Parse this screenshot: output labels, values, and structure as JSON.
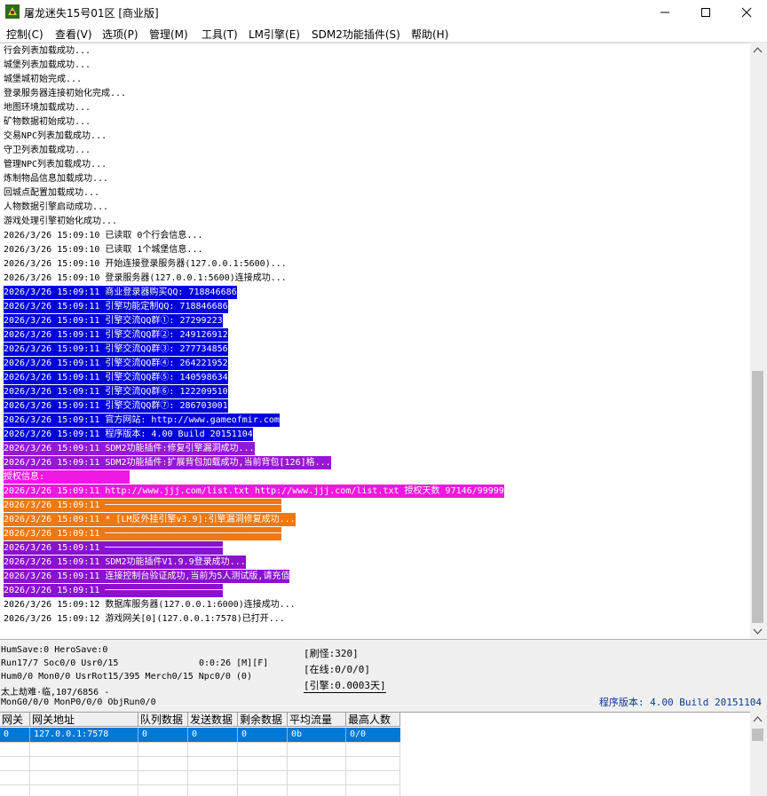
{
  "window": {
    "title": "屠龙迷失15号01区 [商业版]"
  },
  "menu": [
    "控制(C)",
    "查看(V)",
    "选项(P)",
    "管理(M)",
    "工具(T)",
    "LM引擎(E)",
    "SDM2功能插件(S)",
    "帮助(H)"
  ],
  "log": [
    {
      "text": "行会列表加载成功...",
      "style": "plain"
    },
    {
      "text": "城堡列表加载成功...",
      "style": "plain"
    },
    {
      "text": "城堡城初始完成...",
      "style": "plain"
    },
    {
      "text": "登录服务器连接初始化完成...",
      "style": "plain"
    },
    {
      "text": "地图环境加载成功...",
      "style": "plain"
    },
    {
      "text": "矿物数据初始成功...",
      "style": "plain"
    },
    {
      "text": "交易NPC列表加载成功...",
      "style": "plain"
    },
    {
      "text": "守卫列表加载成功...",
      "style": "plain"
    },
    {
      "text": "管理NPC列表加载成功...",
      "style": "plain"
    },
    {
      "text": "炼制物品信息加载成功...",
      "style": "plain"
    },
    {
      "text": "回城点配置加载成功...",
      "style": "plain"
    },
    {
      "text": "人物数据引擎启动成功...",
      "style": "plain"
    },
    {
      "text": "游戏处理引擎初始化成功...",
      "style": "plain"
    },
    {
      "text": "2026/3/26 15:09:10 已读取 0个行会信息...",
      "style": "plain"
    },
    {
      "text": "2026/3/26 15:09:10 已读取 1个城堡信息...",
      "style": "plain"
    },
    {
      "text": "2026/3/26 15:09:10 开始连接登录服务器(127.0.0.1:5600)...",
      "style": "plain"
    },
    {
      "text": "2026/3/26 15:09:10 登录服务器(127.0.0.1:5600)连接成功...",
      "style": "plain"
    },
    {
      "text": "2026/3/26 15:09:11 商业登录器购买QQ: 718846686",
      "style": "blue"
    },
    {
      "text": "2026/3/26 15:09:11 引擎功能定制QQ: 718846686",
      "style": "blue"
    },
    {
      "text": "2026/3/26 15:09:11 引擎交流QQ群①: 27299223",
      "style": "blue"
    },
    {
      "text": "2026/3/26 15:09:11 引擎交流QQ群②: 249126912",
      "style": "blue"
    },
    {
      "text": "2026/3/26 15:09:11 引擎交流QQ群③: 277734856",
      "style": "blue"
    },
    {
      "text": "2026/3/26 15:09:11 引擎交流QQ群④: 264221952",
      "style": "blue"
    },
    {
      "text": "2026/3/26 15:09:11 引擎交流QQ群⑤: 140598634",
      "style": "blue"
    },
    {
      "text": "2026/3/26 15:09:11 引擎交流QQ群⑥: 122209510",
      "style": "blue"
    },
    {
      "text": "2026/3/26 15:09:11 引擎交流QQ群⑦: 286703001",
      "style": "blue"
    },
    {
      "text": "2026/3/26 15:09:11 官方网站: http://www.gameofmir.com",
      "style": "blue"
    },
    {
      "text": "2026/3/26 15:09:11 程序版本: 4.00 Build 20151104",
      "style": "blue"
    },
    {
      "text": "2026/3/26 15:09:11 SDM2功能插件:修复引擎漏洞成功...",
      "style": "purple"
    },
    {
      "text": "2026/3/26 15:09:11 SDM2功能插件:扩展背包加载成功,当前背包[126]格...",
      "style": "purple"
    },
    {
      "text": "授权信息:                ",
      "style": "magenta"
    },
    {
      "text": "2026/3/26 15:09:11 http://www.jjj.com/list.txt http://www.jjj.com/list.txt 授权天数 97146/99999",
      "style": "magenta"
    },
    {
      "text": "2026/3/26 15:09:11 ─────────────────────────────────",
      "style": "orange"
    },
    {
      "text": "2026/3/26 15:09:11 * [LM反外挂引擎v3.9]:引擎漏洞修复成功...",
      "style": "orange"
    },
    {
      "text": "2026/3/26 15:09:11 ─────────────────────────────────",
      "style": "orange"
    },
    {
      "text": "2026/3/26 15:09:11 ──────────────────────",
      "style": "purple2"
    },
    {
      "text": "2026/3/26 15:09:11 SDM2功能插件V1.9.9登录成功...",
      "style": "purple2"
    },
    {
      "text": "2026/3/26 15:09:11 连接控制台验证成功,当前为5人测试版,请充值",
      "style": "purple2"
    },
    {
      "text": "2026/3/26 15:09:11 ──────────────────────",
      "style": "purple2"
    },
    {
      "text": "2026/3/26 15:09:12 数据库服务器(127.0.0.1:6000)连接成功...",
      "style": "plain"
    },
    {
      "text": "2026/3/26 15:09:12 游戏网关[0](127.0.0.1:7578)已打开...",
      "style": "plain"
    }
  ],
  "status": {
    "line1": "HumSave:0 HeroSave:0",
    "line2": "Run17/7 Soc0/0 Usr0/15",
    "timer": "0:0:26 [M][F]",
    "line3": "Hum0/0 Mon0/0 UsrRot15/395 Merch0/15 Npc0/0 (0)",
    "line4": "太上劫难·临,107/6856 -",
    "line5": "MonG0/0/0 MonP0/0/0 ObjRun0/0",
    "refresh": "[刷怪:320]",
    "online": "[在线:0/0/0]",
    "engine": "[引擎:0.0003天]",
    "version": "程序版本: 4.00 Build 20151104"
  },
  "grid": {
    "headers": [
      "网关",
      "网关地址",
      "队列数据",
      "发送数据",
      "剩余数据",
      "平均流量",
      "最高人数"
    ],
    "rows": [
      [
        "0",
        "127.0.0.1:7578",
        "0",
        "0",
        "0",
        "0b",
        "0/0"
      ]
    ]
  },
  "colors": {
    "blue": "#0000dc",
    "purple": "#9717d4",
    "magenta": "#ef18e0",
    "orange": "#f07810",
    "selection": "#0078d7"
  },
  "icons": [
    "app-icon",
    "minimize-icon",
    "maximize-icon",
    "close-icon",
    "scroll-up-icon",
    "scroll-down-icon"
  ]
}
